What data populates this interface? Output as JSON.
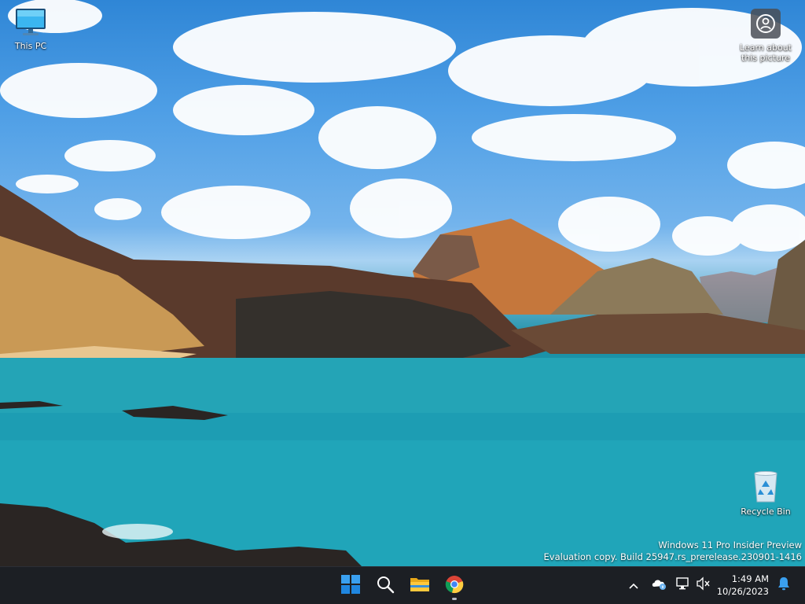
{
  "desktop": {
    "icons": [
      {
        "label": "This PC",
        "icon": "monitor-icon"
      },
      {
        "label": "Learn about\nthis picture",
        "icon": "camera-info-icon"
      },
      {
        "label": "Recycle Bin",
        "icon": "recycle-bin-icon"
      }
    ],
    "watermark": {
      "line1": "Windows 11 Pro Insider Preview",
      "line2": "Evaluation copy. Build 25947.rs_prerelease.230901-1416"
    }
  },
  "taskbar": {
    "apps": [
      {
        "name": "Start",
        "icon": "windows-start-icon"
      },
      {
        "name": "Search",
        "icon": "search-icon"
      },
      {
        "name": "File Explorer",
        "icon": "folder-icon"
      },
      {
        "name": "Google Chrome",
        "icon": "chrome-icon",
        "running": true
      }
    ],
    "tray": {
      "icons": [
        "chevron-up-icon",
        "onedrive-icon",
        "network-icon",
        "volume-muted-icon"
      ]
    },
    "clock": {
      "time": "1:49 AM",
      "date": "10/26/2023"
    },
    "notification_icon": "bell-icon"
  },
  "colors": {
    "taskbar_bg": "#1c1f24",
    "accent_blue": "#0078d4",
    "sea": "#1f9eb0",
    "sky": "#4f9fe6"
  }
}
